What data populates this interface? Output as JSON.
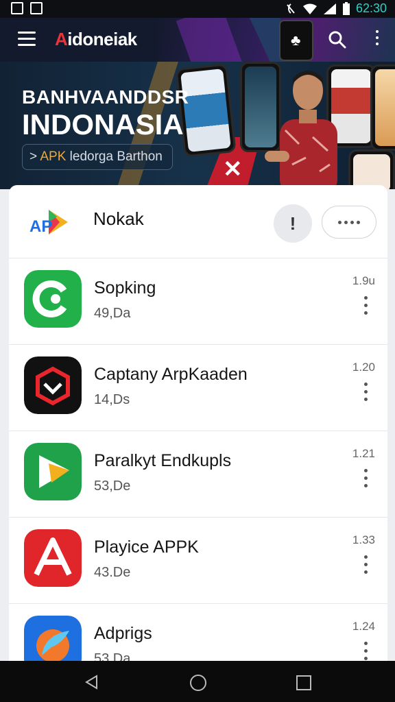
{
  "status_bar": {
    "time": "62:30"
  },
  "app_bar": {
    "brand_a": "A",
    "brand_rest": "idoneiak"
  },
  "banner": {
    "title_line1": "BANHVAANDDSR",
    "title_line2": "INDONASIA",
    "cta_arrow": ">",
    "cta_apk": "APK",
    "cta_text": "ledorga Barthon"
  },
  "list_header": {
    "title": "Nokak",
    "help_label": "!"
  },
  "apps": [
    {
      "name": "Sopking",
      "size": "49,Da",
      "version": "1.9u",
      "color": "#22b04b"
    },
    {
      "name": "Captany ArpKaaden",
      "size": "14,Ds",
      "version": "1.20",
      "color": "#111111"
    },
    {
      "name": "Paralkyt Endkupls",
      "size": "53,De",
      "version": "1.21",
      "color": "#1fa24a"
    },
    {
      "name": "Playice APPK",
      "size": "43.De",
      "version": "1.33",
      "color": "#e0262b"
    },
    {
      "name": "Adprigs",
      "size": "53,Da",
      "version": "1.24",
      "color": "#1e6fe0"
    }
  ]
}
